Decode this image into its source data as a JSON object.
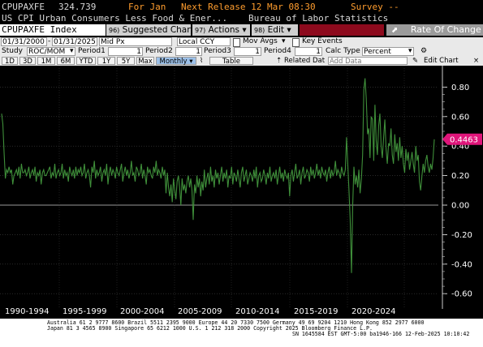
{
  "header": {
    "ticker": "CPUPAXFE",
    "price": "324.739",
    "period": "For Jan",
    "next_release": "Next Release 12 Mar 08:30",
    "survey": "Survey --",
    "description": "US CPI Urban Consumers Less Food & Ener...",
    "source": "Bureau of Labor Statistics"
  },
  "toolbar": {
    "security": "CPUPAXFE Index",
    "suggested_num": "96)",
    "suggested_label": "Suggested Charts",
    "actions_num": "97)",
    "actions_label": "Actions",
    "edit_num": "98)",
    "edit_label": "Edit",
    "rate_label": "Rate Of Change",
    "rate_icon": "export-icon"
  },
  "controls": {
    "start_date": "01/31/2000",
    "end_date": "01/31/2025",
    "price_field": "Mid Px",
    "currency": "Local CCY",
    "mov_avgs": "Mov Avgs",
    "key_events": "Key Events",
    "study_label": "Study",
    "study": "ROC/MOM",
    "period1_label": "Period1",
    "period1": "1",
    "period2_label": "Period2",
    "period2": "1",
    "period3_label": "Period3",
    "period3": "1",
    "period4_label": "Period4",
    "period4": "1",
    "calc_type_label": "Calc Type",
    "calc_type": "Percent",
    "periods": [
      "1D",
      "3D",
      "1M",
      "6M",
      "YTD",
      "1Y",
      "5Y",
      "Max"
    ],
    "frequency": "Monthly",
    "table_label": "Table",
    "related_data": "Related Dat",
    "add_data": "Add Data",
    "edit_chart": "Edit Chart"
  },
  "footer": {
    "line1": "Australia 61 2 9777 8600 Brazil 5511 2395 9000 Europe 44 20 7330 7500 Germany 49 69 9204 1210 Hong Kong 852 2977 6000",
    "line2": "Japan 81 3 4565 8900          Singapore 65 6212 1000          U.S. 1 212 318 2000          Copyright 2025 Bloomberg Finance L.P.",
    "line3": "SN 1645584 EST  GMT-5:00 ba1946-166 12-Feb-2025 10:10:42"
  },
  "colors": {
    "background": "#000000",
    "line": "#3f8f3a",
    "last_value_tag": "#e0157a",
    "zero_line": "#9a9a9a",
    "edit_bar": "#8d0a1d"
  },
  "chart_data": {
    "type": "line",
    "title": "",
    "xlabel": "",
    "ylabel": "",
    "x_range": [
      "2000-01",
      "2025-01"
    ],
    "frequency": "monthly",
    "ylim": [
      -0.65,
      0.9
    ],
    "yticks": [
      -0.6,
      -0.4,
      -0.2,
      0.0,
      0.2,
      0.4,
      0.6,
      0.8
    ],
    "ytick_labels": [
      "-0.60",
      "-0.40",
      "-0.20",
      "0.00",
      "0.20",
      "0.40",
      "0.60",
      "0.80"
    ],
    "x_period_labels": [
      "1990-1994",
      "1995-1999",
      "2000-2004",
      "2005-2009",
      "2010-2014",
      "2015-2019",
      "2020-2024"
    ],
    "last_value_label": "0.4463",
    "series": [
      {
        "values": [
          0.62,
          0.55,
          0.36,
          0.18,
          0.24,
          0.22,
          0.26,
          0.22,
          0.24,
          0.14,
          0.2,
          0.22,
          0.24,
          0.2,
          0.26,
          0.18,
          0.28,
          0.22,
          0.22,
          0.24,
          0.2,
          0.22,
          0.26,
          0.18,
          0.22,
          0.24,
          0.2,
          0.26,
          0.16,
          0.22,
          0.2,
          0.24,
          0.14,
          0.22,
          0.24,
          0.2,
          0.2,
          0.22,
          0.24,
          0.26,
          0.18,
          0.22,
          0.2,
          0.28,
          0.18,
          0.22,
          0.24,
          0.2,
          0.22,
          0.28,
          0.18,
          0.24,
          0.2,
          0.22,
          0.16,
          0.26,
          0.22,
          0.2,
          0.24,
          0.18,
          0.26,
          0.2,
          0.24,
          0.22,
          0.26,
          0.2,
          0.22,
          0.28,
          0.18,
          0.22,
          0.24,
          0.2,
          0.12,
          0.26,
          0.22,
          0.3,
          0.18,
          0.24,
          0.2,
          0.22,
          0.26,
          0.16,
          0.22,
          0.24,
          0.2,
          0.28,
          0.14,
          0.22,
          0.26,
          0.2,
          0.24,
          0.22,
          0.18,
          0.26,
          0.22,
          0.2,
          0.24,
          0.28,
          0.16,
          0.22,
          0.26,
          0.2,
          0.24,
          0.18,
          0.22,
          0.3,
          0.2,
          0.22,
          0.16,
          0.26,
          0.24,
          0.2,
          0.22,
          0.28,
          0.18,
          0.24,
          0.2,
          0.14,
          0.26,
          0.22,
          0.24,
          0.2,
          0.18,
          0.26,
          0.22,
          0.3,
          0.2,
          0.24,
          0.22,
          0.18,
          0.26,
          0.2,
          0.24,
          0.08,
          0.22,
          0.12,
          0.06,
          0.14,
          0.02,
          0.18,
          0.1,
          0.04,
          0.16,
          0.2,
          0.12,
          0.0,
          0.18,
          0.1,
          0.14,
          0.08,
          0.16,
          0.2,
          0.12,
          0.18,
          0.1,
          -0.1,
          0.14,
          0.08,
          0.2,
          0.12,
          0.18,
          0.06,
          0.16,
          0.1,
          0.24,
          0.12,
          0.18,
          0.22,
          0.14,
          0.26,
          0.16,
          0.2,
          0.12,
          0.24,
          0.18,
          0.22,
          0.14,
          0.2,
          0.26,
          0.16,
          0.22,
          0.18,
          0.24,
          0.12,
          0.2,
          0.18,
          0.26,
          0.14,
          0.22,
          0.2,
          0.16,
          0.24,
          0.18,
          0.12,
          0.22,
          0.26,
          0.16,
          0.2,
          0.24,
          0.14,
          0.18,
          0.22,
          0.2,
          0.16,
          0.24,
          0.18,
          0.26,
          0.12,
          0.2,
          0.22,
          0.16,
          0.18,
          0.24,
          0.2,
          0.14,
          0.22,
          0.18,
          0.26,
          0.16,
          0.2,
          0.22,
          0.18,
          0.24,
          0.14,
          0.2,
          0.26,
          0.18,
          0.22,
          0.16,
          0.24,
          0.2,
          0.18,
          0.22,
          0.06,
          0.2,
          0.24,
          0.16,
          0.22,
          0.28,
          0.18,
          0.2,
          0.24,
          0.14,
          0.22,
          0.26,
          0.18,
          0.2,
          0.24,
          0.22,
          0.16,
          0.26,
          0.2,
          0.24,
          0.18,
          0.22,
          0.28,
          0.2,
          0.24,
          0.18,
          0.26,
          0.22,
          0.2,
          0.24,
          0.16,
          0.22,
          0.26,
          0.18,
          0.24,
          0.2,
          0.22,
          0.3,
          0.2,
          0.24,
          0.22,
          0.18,
          0.26,
          0.22,
          0.2,
          0.24,
          0.46,
          0.28,
          0.1,
          -0.1,
          -0.46,
          0.0,
          0.26,
          0.14,
          0.2,
          0.12,
          0.24,
          0.08,
          0.18,
          0.34,
          0.78,
          0.86,
          0.72,
          0.48,
          0.52,
          0.32,
          0.6,
          0.58,
          0.3,
          0.68,
          0.44,
          0.34,
          0.54,
          0.62,
          0.4,
          0.32,
          0.46,
          0.58,
          0.38,
          0.28,
          0.42,
          0.4,
          0.52,
          0.34,
          0.28,
          0.48,
          0.36,
          0.42,
          0.3,
          0.46,
          0.32,
          0.4,
          0.28,
          0.22,
          0.38,
          0.3,
          0.36,
          0.24,
          0.3,
          0.36,
          0.28,
          0.22,
          0.4,
          0.3,
          0.34,
          0.16,
          0.1,
          0.2,
          0.28,
          0.22,
          0.3,
          0.34,
          0.26,
          0.22,
          0.28,
          0.24,
          0.32,
          0.4463
        ]
      }
    ]
  }
}
